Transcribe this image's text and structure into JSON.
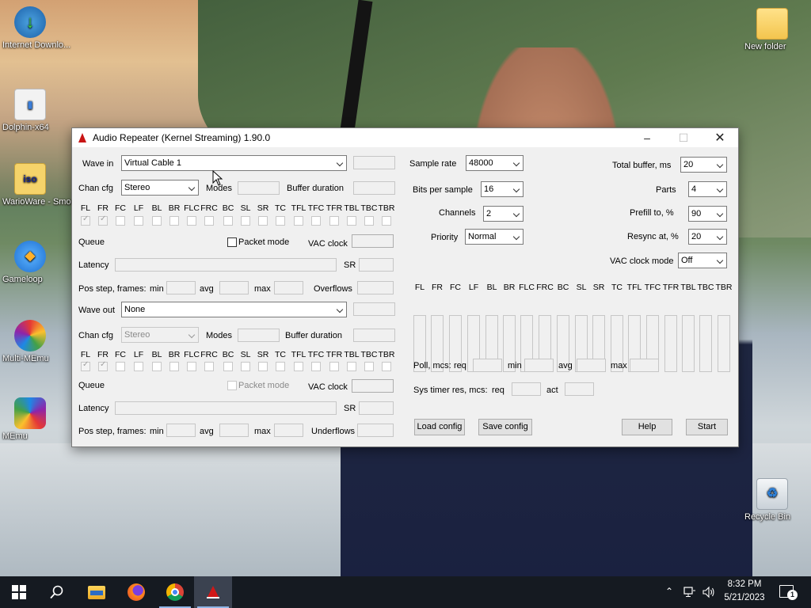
{
  "desktop_icons": [
    {
      "label": "Internet Downlo..."
    },
    {
      "label": "Dolphin-x64"
    },
    {
      "label": "WarioWare - Smooth M..."
    },
    {
      "label": "Gameloop"
    },
    {
      "label": "Multi-MEmu"
    },
    {
      "label": "MEmu"
    },
    {
      "label": "New folder"
    },
    {
      "label": "Recycle Bin"
    }
  ],
  "window": {
    "title": "Audio Repeater (Kernel Streaming) 1.90.0",
    "wave_in": {
      "label": "Wave in",
      "device": "Virtual Cable 1",
      "chan_cfg_label": "Chan cfg",
      "chan_cfg": "Stereo",
      "modes_label": "Modes",
      "buffer_duration_label": "Buffer duration",
      "channels": [
        "FL",
        "FR",
        "FC",
        "LF",
        "BL",
        "BR",
        "FLC",
        "FRC",
        "BC",
        "SL",
        "SR",
        "TC",
        "TFL",
        "TFC",
        "TFR",
        "TBL",
        "TBC",
        "TBR"
      ],
      "checked": [
        "FL",
        "FR"
      ],
      "queue_label": "Queue",
      "packet_mode_label": "Packet mode",
      "vac_clock_label": "VAC clock",
      "latency_label": "Latency",
      "sr_label": "SR",
      "pos_step_label": "Pos step, frames:",
      "min_label": "min",
      "avg_label": "avg",
      "max_label": "max",
      "overflows_label": "Overflows"
    },
    "wave_out": {
      "label": "Wave out",
      "device": "None",
      "chan_cfg_label": "Chan cfg",
      "chan_cfg": "Stereo",
      "modes_label": "Modes",
      "buffer_duration_label": "Buffer duration",
      "channels": [
        "FL",
        "FR",
        "FC",
        "LF",
        "BL",
        "BR",
        "FLC",
        "FRC",
        "BC",
        "SL",
        "SR",
        "TC",
        "TFL",
        "TFC",
        "TFR",
        "TBL",
        "TBC",
        "TBR"
      ],
      "checked": [
        "FL",
        "FR"
      ],
      "queue_label": "Queue",
      "packet_mode_label": "Packet mode",
      "vac_clock_label": "VAC clock",
      "latency_label": "Latency",
      "sr_label": "SR",
      "pos_step_label": "Pos step, frames:",
      "min_label": "min",
      "avg_label": "avg",
      "max_label": "max",
      "underflows_label": "Underflows"
    },
    "format": {
      "sample_rate_label": "Sample rate",
      "sample_rate": "48000",
      "bits_label": "Bits per sample",
      "bits": "16",
      "channels_label": "Channels",
      "channels": "2",
      "priority_label": "Priority",
      "priority": "Normal"
    },
    "buffers": {
      "total_buffer_label": "Total buffer, ms",
      "total_buffer": "20",
      "parts_label": "Parts",
      "parts": "4",
      "prefill_label": "Prefill to, %",
      "prefill": "90",
      "resync_label": "Resync at, %",
      "resync": "20",
      "vac_clock_mode_label": "VAC clock mode",
      "vac_clock_mode": "Off"
    },
    "meters": [
      "FL",
      "FR",
      "FC",
      "LF",
      "BL",
      "BR",
      "FLC",
      "FRC",
      "BC",
      "SL",
      "SR",
      "TC",
      "TFL",
      "TFC",
      "TFR",
      "TBL",
      "TBC",
      "TBR"
    ],
    "poll": {
      "label": "Poll, mcs:",
      "req": "req",
      "min": "min",
      "avg": "avg",
      "max": "max"
    },
    "systimer": {
      "label": "Sys timer res, mcs:",
      "req": "req",
      "act": "act"
    },
    "buttons": {
      "load": "Load config",
      "save": "Save config",
      "help": "Help",
      "start": "Start"
    }
  },
  "taskbar": {
    "time": "8:32 PM",
    "date": "5/21/2023",
    "notifications": "1"
  }
}
